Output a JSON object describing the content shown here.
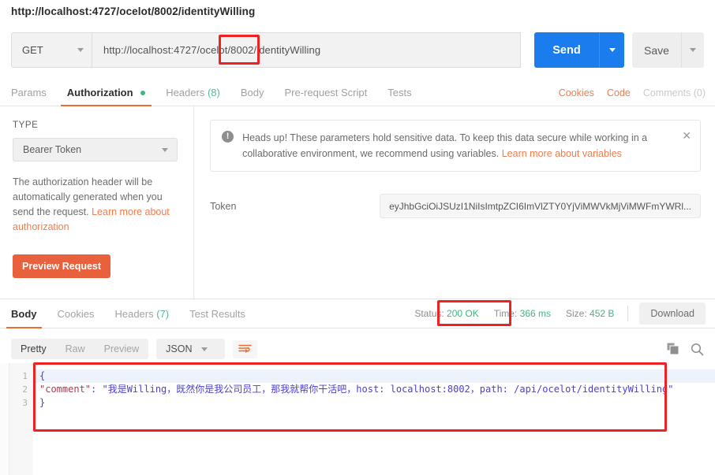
{
  "window": {
    "title": "http://localhost:4727/ocelot/8002/identityWilling"
  },
  "request": {
    "method": "GET",
    "url": "http://localhost:4727/ocelot/8002/identityWilling",
    "send_label": "Send",
    "save_label": "Save",
    "tabs": [
      {
        "label": "Params",
        "active": false
      },
      {
        "label": "Authorization",
        "active": true,
        "dot": true
      },
      {
        "label": "Headers",
        "count": "(8)",
        "active": false
      },
      {
        "label": "Body",
        "active": false
      },
      {
        "label": "Pre-request Script",
        "active": false
      },
      {
        "label": "Tests",
        "active": false
      }
    ],
    "right_links": [
      {
        "label": "Cookies",
        "muted": false
      },
      {
        "label": "Code",
        "muted": false
      },
      {
        "label": "Comments (0)",
        "muted": true
      }
    ]
  },
  "auth": {
    "type_label": "TYPE",
    "type_value": "Bearer Token",
    "description": "The authorization header will be automatically generated when you send the request.",
    "description_link": "Learn more about authorization",
    "preview_button": "Preview Request",
    "notice": {
      "icon": "!",
      "text": "Heads up! These parameters hold sensitive data. To keep this data secure while working in a collaborative environment, we recommend using variables.",
      "link": "Learn more about variables",
      "close": "✕"
    },
    "token_label": "Token",
    "token_value": "eyJhbGciOiJSUzI1NiIsImtpZCI6ImVlZTY0YjViMWVkMjViMWFmYWRl..."
  },
  "response": {
    "tabs": [
      {
        "label": "Body",
        "active": true
      },
      {
        "label": "Cookies",
        "active": false
      },
      {
        "label": "Headers",
        "count": "(7)",
        "active": false
      },
      {
        "label": "Test Results",
        "active": false
      }
    ],
    "status_label": "Status:",
    "status_value": "200 OK",
    "time_label": "Time:",
    "time_value": "366 ms",
    "size_label": "Size:",
    "size_value": "452 B",
    "download_label": "Download",
    "view_modes": [
      {
        "label": "Pretty",
        "active": true
      },
      {
        "label": "Raw",
        "active": false
      },
      {
        "label": "Preview",
        "active": false
      }
    ],
    "format": "JSON",
    "line_numbers": [
      "1",
      "2",
      "3"
    ],
    "body_open": "{",
    "body_key": "\"comment\"",
    "body_colon": ": ",
    "body_value": "\"我是Willing，既然你是我公司员工，那我就帮你干活吧，host: localhost:8002，path: /api/ocelot/identityWilling\"",
    "body_close": "}"
  },
  "icons": {
    "copy": "copy-icon",
    "search": "search-icon",
    "wrap": "wrap-lines-icon"
  },
  "colors": {
    "accent_orange": "#ef6c2d",
    "send_blue": "#1a7ced",
    "status_green": "#43b581",
    "annotation_red": "#ee2222"
  }
}
